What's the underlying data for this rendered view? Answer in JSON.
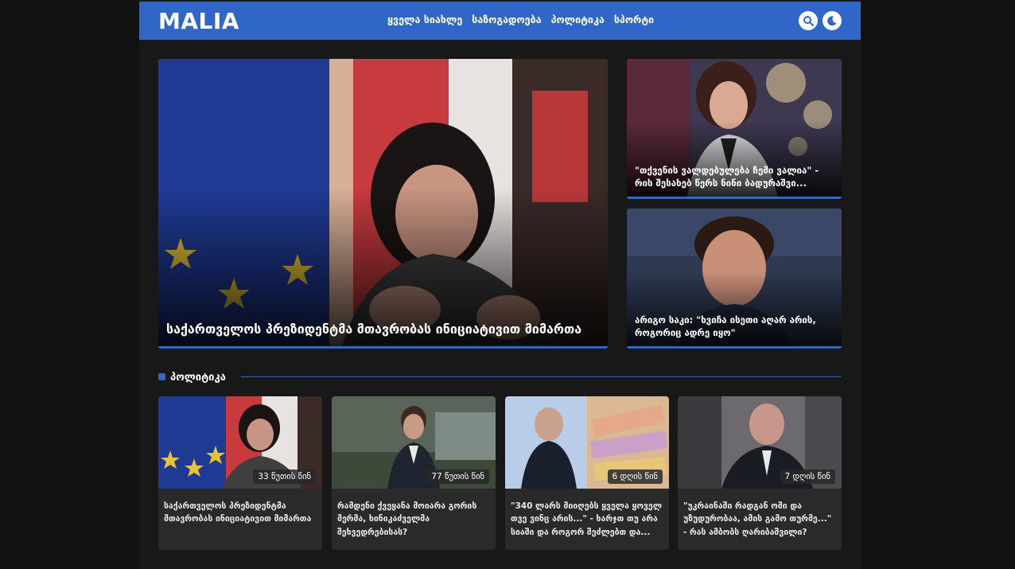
{
  "header": {
    "logo": "MALIA",
    "nav": [
      "ყველა სიახლე",
      "საზოგადოება",
      "პოლიტიკა",
      "სპორტი"
    ]
  },
  "featured": {
    "main_title": "საქართველოს პრეზიდენტმა მთავრობას ინიციატივით მიმართა",
    "side": [
      {
        "title": "\"თქვენის ვალდებულება ჩემი ვალია\" - რის შესახებ წერს ნინი ბადურაშვი..."
      },
      {
        "title": "არიგო საკი: \"ხვიჩა ისეთი აღარ არის, როგორიც ადრე იყო\""
      }
    ]
  },
  "section": {
    "title": "პოლიტიკა"
  },
  "articles": [
    {
      "time": "33 წუთის წინ",
      "title": "საქართველოს პრეზიდენტმა მთავრობას ინიციატივით მიმართა"
    },
    {
      "time": "77 წუთის წინ",
      "title": "რამდენი ქვეყანა მოიარა გორის მერმა, ხინიკაძველმა შეხვედრებისას?"
    },
    {
      "time": "6 დღის წინ",
      "title": "\"340 ლარს მიიღებს ყველა ყოველ თვე ვინც არის...\" - ხარჯთ თუ არა სიაში და როგორ შეძლებთ და..."
    },
    {
      "time": "7 დღის წინ",
      "title": "\"უკრაინაში რადგან ომი და უზუდურობაა, ამის გამო თურმე...\" - რას ამბობს ღარიბაშვილი?"
    }
  ],
  "colors": {
    "accent": "#2f66c8",
    "background": "#181818",
    "card": "#2a2a2a"
  }
}
